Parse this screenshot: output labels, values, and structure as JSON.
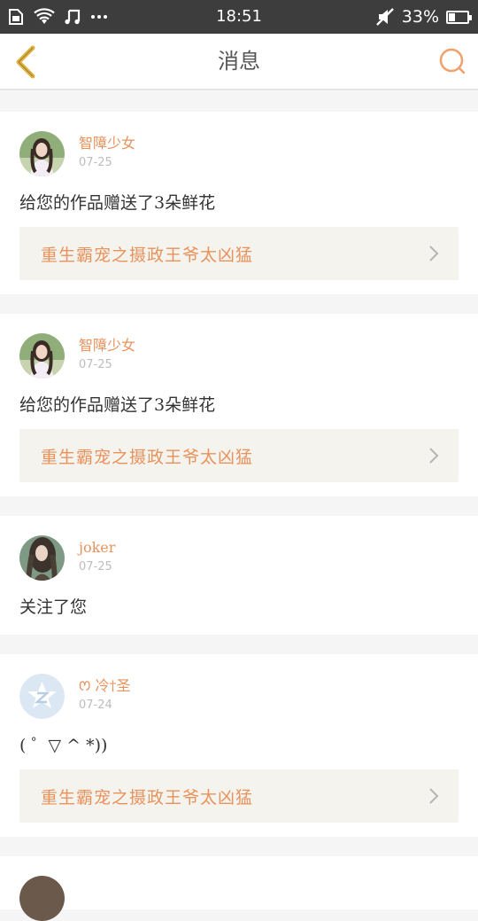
{
  "status": {
    "time": "18:51",
    "battery": "33%",
    "battery_level": 0.33
  },
  "nav": {
    "title": "消息"
  },
  "colors": {
    "accent": "#e8925c",
    "status_bar": "#3d3d3d",
    "back_arrow": "#e0b341"
  },
  "messages": [
    {
      "user": "智障少女",
      "date": "07-25",
      "text": "给您的作品赠送了3朵鲜花",
      "link": "重生霸宠之摄政王爷太凶猛",
      "avatar": "girl-avatar"
    },
    {
      "user": "智障少女",
      "date": "07-25",
      "text": "给您的作品赠送了3朵鲜花",
      "link": "重生霸宠之摄政王爷太凶猛",
      "avatar": "girl-avatar"
    },
    {
      "user": "joker",
      "date": "07-25",
      "text": "关注了您",
      "avatar": "girl-avatar-dark"
    },
    {
      "user": "ꯁ 冷†圣",
      "date": "07-24",
      "text": "( ゜▽ ^ *))",
      "link": "重生霸宠之摄政王爷太凶猛",
      "avatar": "qq-default-avatar"
    }
  ]
}
